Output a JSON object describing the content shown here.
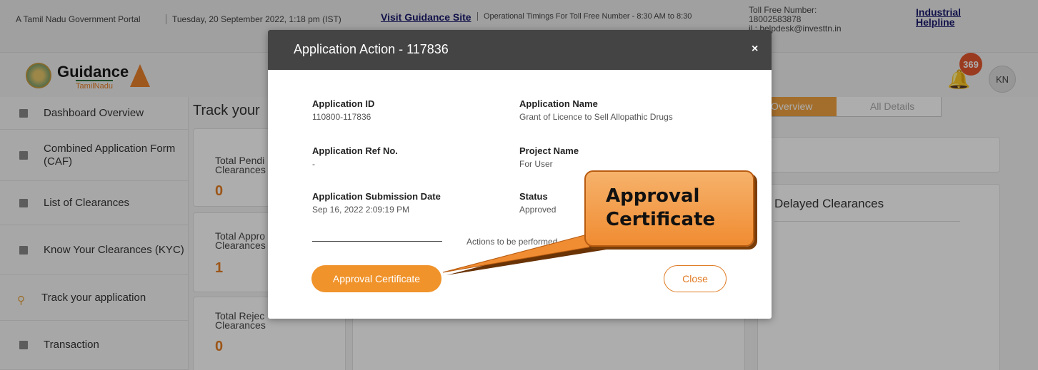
{
  "topbar": {
    "gov_portal": "A Tamil Nadu Government Portal",
    "date_line": "Tuesday, 20 September 2022, 1:18 pm (IST)",
    "visit_link": "Visit Guidance Site",
    "timings": "Operational Timings For Toll Free Number - 8:30 AM to 8:30",
    "tollfree_label": "Toll Free Number:",
    "tollfree_number": "18002583878",
    "email": "il : helpdesk@investtn.in",
    "helpline": "Industrial Helpline"
  },
  "header": {
    "brand": "Guidance",
    "brand_sub": "TamilNadu",
    "notification_count": "369",
    "avatar_initials": "KN"
  },
  "sidebar": {
    "items": [
      {
        "label": "Dashboard Overview",
        "icon": "grid-icon"
      },
      {
        "label": "Combined Application Form (CAF)",
        "icon": "document-icon"
      },
      {
        "label": "List of Clearances",
        "icon": "list-icon"
      },
      {
        "label": "Know Your Clearances (KYC)",
        "icon": "book-icon"
      },
      {
        "label": "Track your application",
        "icon": "location-pin-icon"
      },
      {
        "label": "Transaction",
        "icon": "card-icon"
      }
    ]
  },
  "main": {
    "title": "Track your",
    "cards": [
      {
        "title": "Total Pendi Clearances",
        "value": "0"
      },
      {
        "title": "Total Appro Clearances",
        "value": "1"
      },
      {
        "title": "Total Rejec Clearances",
        "value": "0"
      }
    ],
    "tabs": [
      "Overview",
      "All Details"
    ],
    "delayed_title": "Delayed Clearances"
  },
  "modal": {
    "title": "Application Action - 117836",
    "close_icon": "×",
    "fields": [
      {
        "label": "Application ID",
        "value": "110800-117836"
      },
      {
        "label": "Application Name",
        "value": "Grant of Licence to Sell Allopathic Drugs"
      },
      {
        "label": "Application Ref No.",
        "value": "-"
      },
      {
        "label": "Project Name",
        "value": "For User"
      },
      {
        "label": "Application Submission Date",
        "value": "Sep 16, 2022 2:09:19 PM"
      },
      {
        "label": "Status",
        "value": "Approved"
      }
    ],
    "actions_text": "Actions to be performed",
    "approval_button": "Approval Certificate",
    "close_button": "Close"
  },
  "callout": {
    "text": "Approval Certificate",
    "color": "#f08c32"
  }
}
